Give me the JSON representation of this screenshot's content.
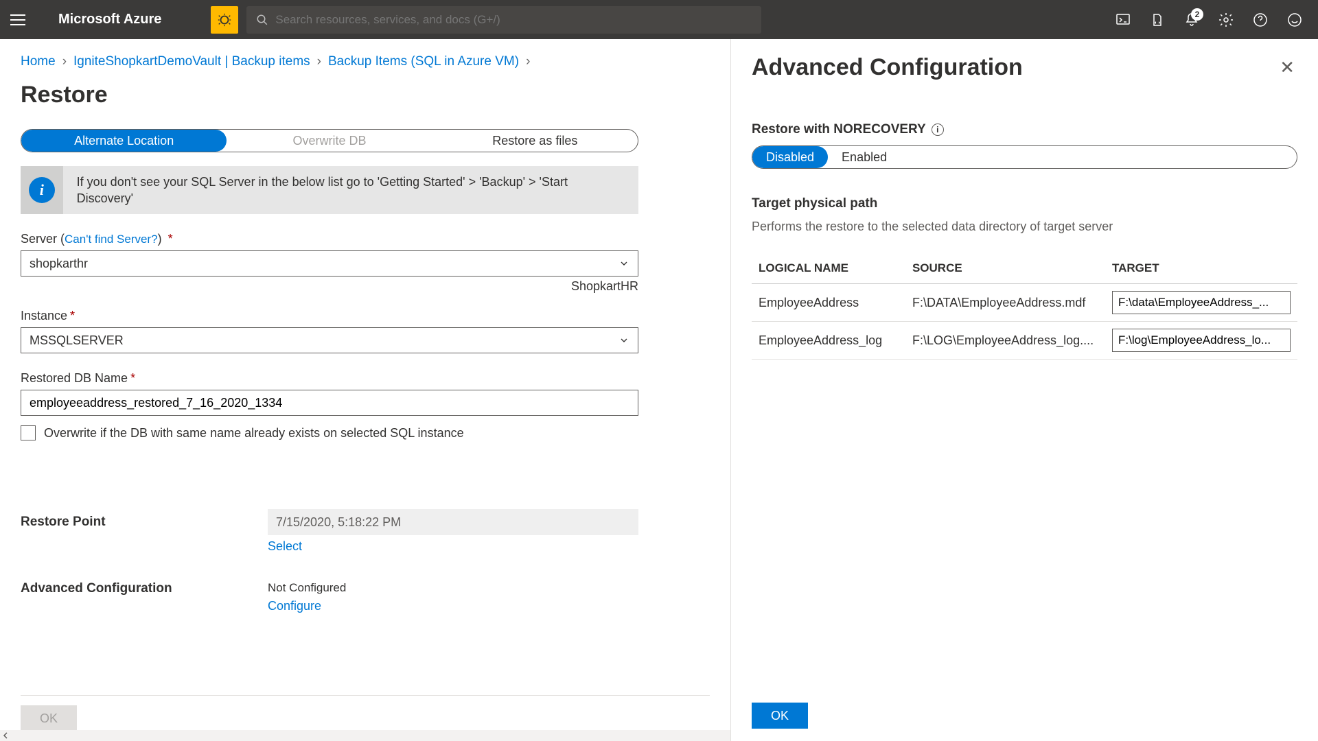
{
  "topbar": {
    "brand": "Microsoft Azure",
    "search_placeholder": "Search resources, services, and docs (G+/)",
    "notification_count": "2"
  },
  "breadcrumb": {
    "items": [
      "Home",
      "IgniteShopkartDemoVault | Backup items",
      "Backup Items (SQL in Azure VM)"
    ]
  },
  "page": {
    "title": "Restore"
  },
  "tabs": {
    "alt_location": "Alternate Location",
    "overwrite": "Overwrite DB",
    "restore_files": "Restore as files"
  },
  "info": {
    "message": "If you don't see your SQL Server in the below list go to 'Getting Started' > 'Backup' > 'Start Discovery'"
  },
  "form": {
    "server_label": "Server",
    "server_link": "Can't find Server?",
    "server_value": "shopkarthr",
    "server_hint": "ShopkartHR",
    "instance_label": "Instance",
    "instance_value": "MSSQLSERVER",
    "dbname_label": "Restored DB Name",
    "dbname_value": "employeeaddress_restored_7_16_2020_1334",
    "overwrite_label": "Overwrite if the DB with same name already exists on selected SQL instance",
    "restore_point_label": "Restore Point",
    "restore_point_value": "7/15/2020, 5:18:22 PM",
    "select_link": "Select",
    "advconfig_label": "Advanced Configuration",
    "advconfig_value": "Not Configured",
    "configure_link": "Configure",
    "ok": "OK"
  },
  "panel": {
    "title": "Advanced Configuration",
    "norecovery_label": "Restore with NORECOVERY",
    "disabled": "Disabled",
    "enabled": "Enabled",
    "targetpath_label": "Target physical path",
    "targetpath_desc": "Performs the restore to the selected data directory of target server",
    "th_logical": "LOGICAL NAME",
    "th_source": "SOURCE",
    "th_target": "TARGET",
    "rows": [
      {
        "logical": "EmployeeAddress",
        "source": "F:\\DATA\\EmployeeAddress.mdf",
        "target": "F:\\data\\EmployeeAddress_..."
      },
      {
        "logical": "EmployeeAddress_log",
        "source": "F:\\LOG\\EmployeeAddress_log....",
        "target": "F:\\log\\EmployeeAddress_lo..."
      }
    ],
    "ok": "OK"
  }
}
